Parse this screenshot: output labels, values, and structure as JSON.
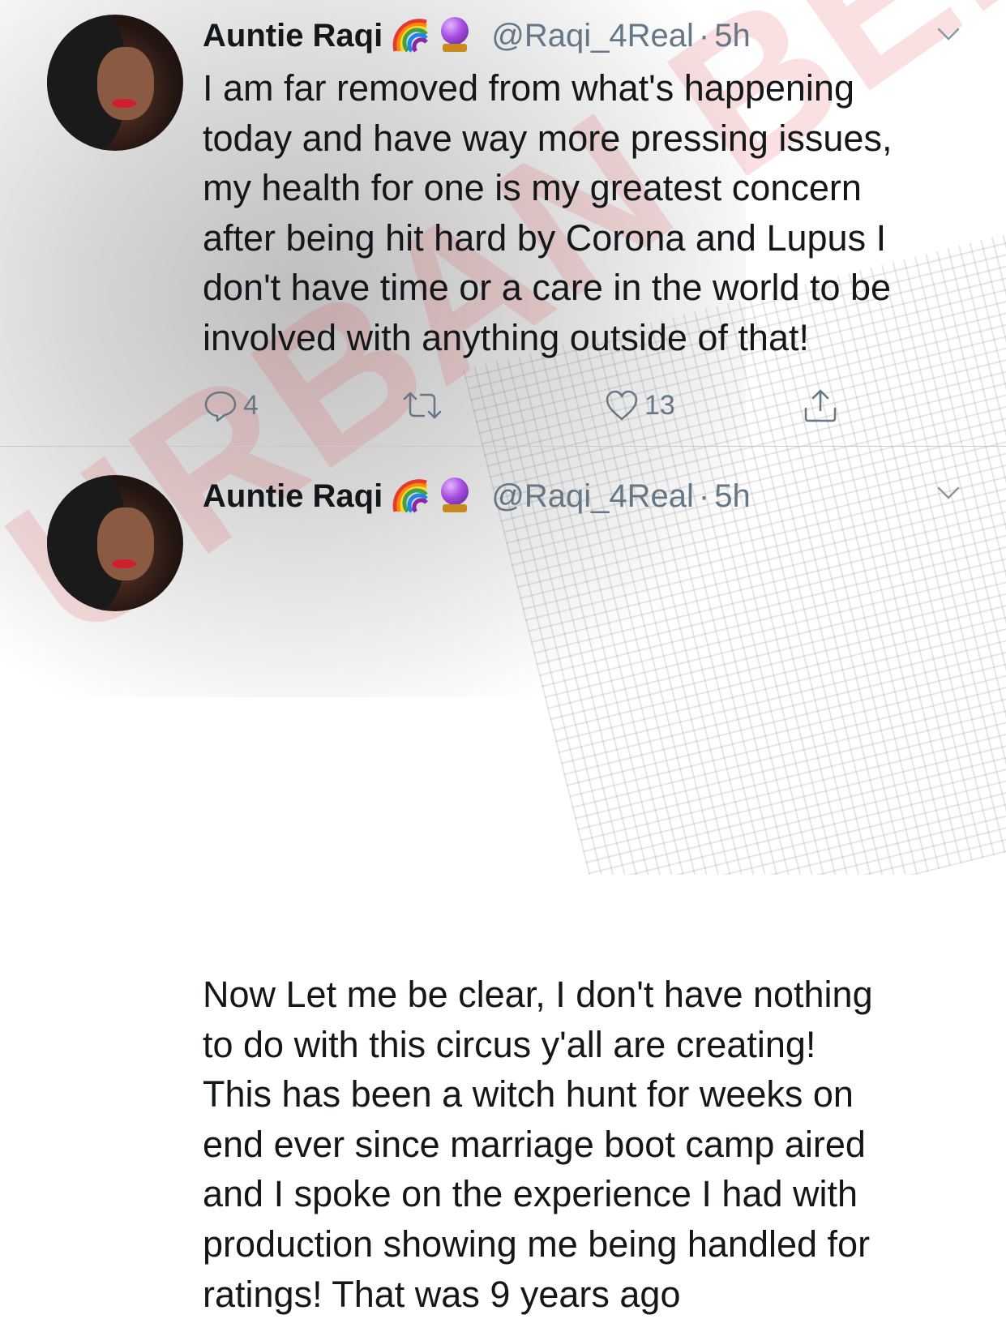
{
  "tweets": [
    {
      "author_name": "Auntie Raqi",
      "emojis": [
        "rainbow-emoji",
        "crystal-ball-emoji"
      ],
      "handle": "@Raqi_4Real",
      "separator": "·",
      "time": "5h",
      "text_lines": [
        "I am far removed from what's happening",
        "today and have way more pressing issues,",
        "my health for one is my greatest concern",
        "after being hit hard by Corona and Lupus I",
        "don't have time or a care in the world to be",
        "involved with anything outside of that!"
      ],
      "actions": {
        "reply_count": "4",
        "retweet_count": "",
        "like_count": "13"
      }
    },
    {
      "author_name": "Auntie Raqi",
      "emojis": [
        "rainbow-emoji",
        "crystal-ball-emoji"
      ],
      "handle": "@Raqi_4Real",
      "separator": "·",
      "time": "5h",
      "text_lines": [
        "Now Let me be clear, I don't have nothing",
        "to do with this circus y'all are creating!",
        "This has been a witch hunt for weeks on",
        "end ever since marriage boot camp aired",
        "and I spoke on the experience I had with",
        "production showing me being handled for",
        "ratings! That was 9 years ago"
      ]
    }
  ],
  "watermark": "URBAN BELLE",
  "colors": {
    "text": "#14171a",
    "secondary": "#657786",
    "divider": "#c8c8c8",
    "watermark": "#e03c3c"
  },
  "icons": {
    "reply": "reply-icon",
    "retweet": "retweet-icon",
    "like": "heart-icon",
    "share": "share-icon",
    "menu": "chevron-down-icon"
  }
}
